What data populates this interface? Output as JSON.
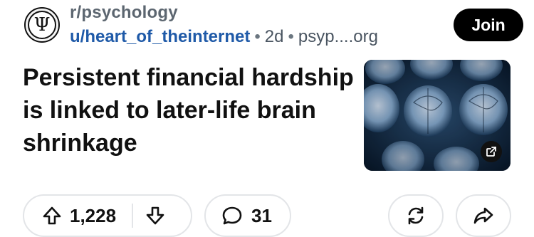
{
  "post": {
    "subreddit": "r/psychology",
    "author": "u/heart_of_theinternet",
    "age": "2d",
    "domain": "psyp....org",
    "separator": "•",
    "title": "Persistent financial hardship is linked to later-life brain shrinkage"
  },
  "actions": {
    "join_label": "Join",
    "upvotes": "1,228",
    "comments": "31"
  },
  "icons": {
    "avatar": "psi-icon",
    "upvote": "arrow-up-icon",
    "downvote": "arrow-down-icon",
    "comment": "speech-bubble-icon",
    "share_alt": "refresh-icon",
    "share": "share-arrow-icon",
    "external_link": "external-link-icon"
  },
  "colors": {
    "username": "#1f5aa8",
    "join_bg": "#000000",
    "border": "#e3e5e8"
  }
}
